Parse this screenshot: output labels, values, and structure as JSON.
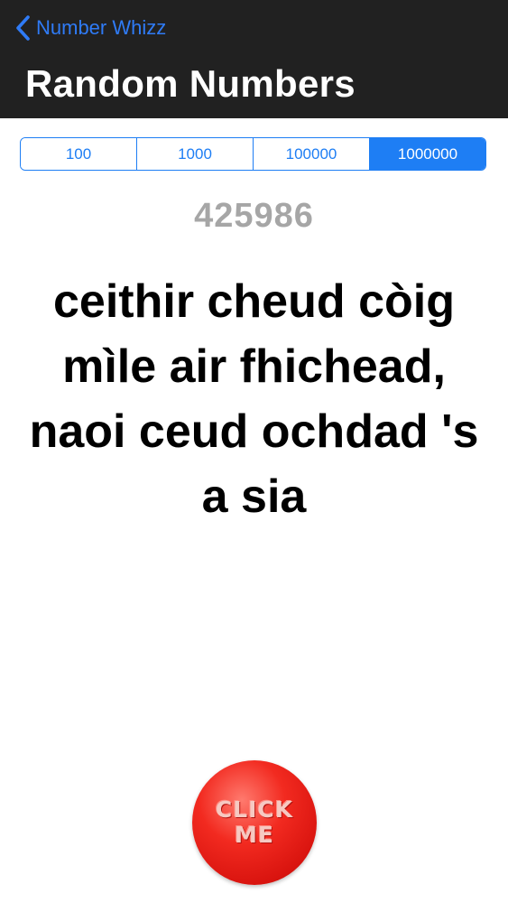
{
  "navbar": {
    "back_label": "Number Whizz",
    "title": "Random Numbers",
    "background_color": "#212121",
    "accent_color": "#2f7bf6"
  },
  "range_selector": {
    "options": [
      "100",
      "1000",
      "100000",
      "1000000"
    ],
    "selected": "1000000",
    "accent_color": "#1e7ef4"
  },
  "number": "425986",
  "number_words": "ceithir cheud còig mìle air fhichead, naoi ceud ochdad 's a sia",
  "click_button": {
    "line1": "CLICK",
    "line2": "ME",
    "color": "#e81a14"
  },
  "icons": {
    "back": "chevron-left-icon"
  }
}
